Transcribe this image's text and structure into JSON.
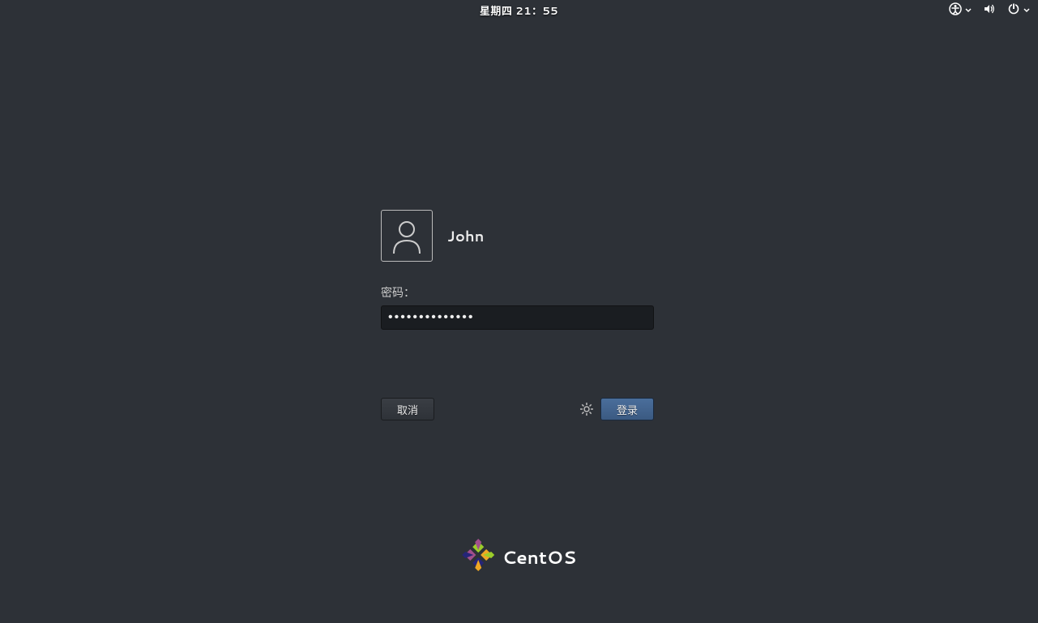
{
  "top_bar": {
    "datetime": "星期四  21：55"
  },
  "login": {
    "username": "John",
    "password_label": "密码：",
    "password_value": "••••••••••••••",
    "cancel_label": "取消",
    "login_label": "登录"
  },
  "branding": {
    "name": "CentOS"
  }
}
